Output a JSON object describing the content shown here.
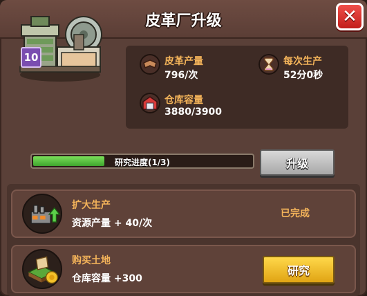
{
  "window": {
    "title": "皮革厂升级"
  },
  "building": {
    "level": "10",
    "icon": "tannery-building-icon"
  },
  "stats": {
    "production": {
      "label": "皮革产量",
      "value": "796/次",
      "icon": "leather-icon"
    },
    "interval": {
      "label": "每次生产",
      "value": "52分0秒",
      "icon": "hourglass-icon"
    },
    "storage": {
      "label": "仓库容量",
      "value": "3880/3900",
      "icon": "warehouse-icon"
    }
  },
  "progress": {
    "text": "研究进度(1/3)",
    "fraction": 0.333
  },
  "upgrade_button": {
    "label": "升级",
    "state": "disabled"
  },
  "research_items": [
    {
      "name": "扩大生产",
      "desc": "资源产量 + 40/次",
      "status": "已完成",
      "icon": "factory-icon"
    },
    {
      "name": "购买土地",
      "desc": "仓库容量 +300",
      "button_label": "研究",
      "icon": "land-coin-icon"
    }
  ],
  "colors": {
    "accent_label": "#f4b45a",
    "progress": "#5cc43e",
    "research_button": "#f0c030",
    "close_button": "#e0332e"
  }
}
